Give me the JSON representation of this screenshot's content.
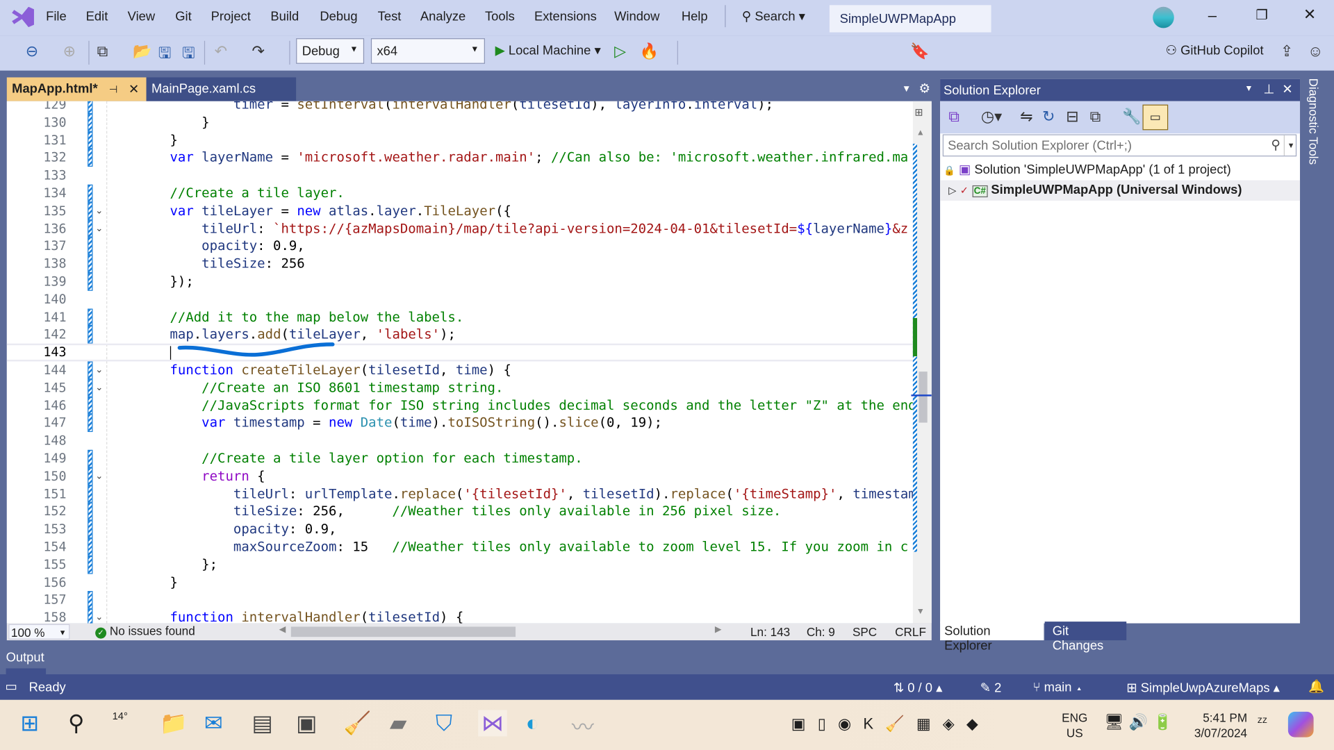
{
  "menu": [
    "File",
    "Edit",
    "View",
    "Git",
    "Project",
    "Build",
    "Debug",
    "Test",
    "Analyze",
    "Tools",
    "Extensions",
    "Window",
    "Help"
  ],
  "search_label": "Search",
  "solution_title": "SimpleUWPMapApp",
  "toolbar": {
    "config": "Debug",
    "platform": "x64",
    "run_target": "Local Machine",
    "copilot": "GitHub Copilot"
  },
  "tabs": [
    {
      "label": "MapApp.html*",
      "active": true
    },
    {
      "label": "MainPage.xaml.cs",
      "active": false
    }
  ],
  "editor": {
    "first_line": 129,
    "current_line": 143,
    "lines": [
      [
        [
          "p",
          "                "
        ],
        [
          "i",
          "timer"
        ],
        [
          "p",
          " = "
        ],
        [
          "f",
          "setInterval"
        ],
        [
          "p",
          "("
        ],
        [
          "f",
          "intervalHandler"
        ],
        [
          "p",
          "("
        ],
        [
          "i",
          "tilesetId"
        ],
        [
          "p",
          "), "
        ],
        [
          "i",
          "layerInfo"
        ],
        [
          "p",
          "."
        ],
        [
          "i",
          "interval"
        ],
        [
          "p",
          ");"
        ]
      ],
      [
        [
          "p",
          "            }"
        ]
      ],
      [
        [
          "p",
          "        }"
        ]
      ],
      [
        [
          "k",
          "        var "
        ],
        [
          "i",
          "layerName"
        ],
        [
          "p",
          " = "
        ],
        [
          "s",
          "'microsoft.weather.radar.main'"
        ],
        [
          "p",
          "; "
        ],
        [
          "c",
          "//Can also be: 'microsoft.weather.infrared.ma"
        ]
      ],
      [],
      [
        [
          "c",
          "        //Create a tile layer."
        ]
      ],
      [
        [
          "k",
          "        var "
        ],
        [
          "i",
          "tileLayer"
        ],
        [
          "p",
          " = "
        ],
        [
          "k",
          "new "
        ],
        [
          "i",
          "atlas"
        ],
        [
          "p",
          "."
        ],
        [
          "i",
          "layer"
        ],
        [
          "p",
          "."
        ],
        [
          "f",
          "TileLayer"
        ],
        [
          "p",
          "({"
        ]
      ],
      [
        [
          "i",
          "            tileUrl"
        ],
        [
          "p",
          ": "
        ],
        [
          "s",
          "`https://{azMapsDomain}/map/tile?api-version=2024-04-01&tilesetId="
        ],
        [
          "k",
          "${"
        ],
        [
          "i",
          "layerName"
        ],
        [
          "k",
          "}"
        ],
        [
          "s",
          "&z"
        ]
      ],
      [
        [
          "i",
          "            opacity"
        ],
        [
          "p",
          ": 0.9,"
        ]
      ],
      [
        [
          "i",
          "            tileSize"
        ],
        [
          "p",
          ": 256"
        ]
      ],
      [
        [
          "p",
          "        });"
        ]
      ],
      [],
      [
        [
          "c",
          "        //Add it to the map below the labels."
        ]
      ],
      [
        [
          "i",
          "        map"
        ],
        [
          "p",
          "."
        ],
        [
          "i",
          "layers"
        ],
        [
          "p",
          "."
        ],
        [
          "f",
          "add"
        ],
        [
          "p",
          "("
        ],
        [
          "i",
          "tileLayer"
        ],
        [
          "p",
          ", "
        ],
        [
          "s",
          "'labels'"
        ],
        [
          "p",
          ");"
        ]
      ],
      [],
      [
        [
          "k",
          "        function "
        ],
        [
          "f",
          "createTileLayer"
        ],
        [
          "p",
          "("
        ],
        [
          "i",
          "tilesetId"
        ],
        [
          "p",
          ", "
        ],
        [
          "i",
          "time"
        ],
        [
          "p",
          ") {"
        ]
      ],
      [
        [
          "c",
          "            //Create an ISO 8601 timestamp string."
        ]
      ],
      [
        [
          "c",
          "            //JavaScripts format for ISO string includes decimal seconds and the letter \"Z\" at the end"
        ]
      ],
      [
        [
          "k",
          "            var "
        ],
        [
          "i",
          "timestamp"
        ],
        [
          "p",
          " = "
        ],
        [
          "k",
          "new "
        ],
        [
          "t",
          "Date"
        ],
        [
          "p",
          "("
        ],
        [
          "i",
          "time"
        ],
        [
          "p",
          ")."
        ],
        [
          "f",
          "toISOString"
        ],
        [
          "p",
          "()."
        ],
        [
          "f",
          "slice"
        ],
        [
          "p",
          "(0, 19);"
        ]
      ],
      [],
      [
        [
          "c",
          "            //Create a tile layer option for each timestamp."
        ]
      ],
      [
        [
          "r",
          "            return"
        ],
        [
          "p",
          " {"
        ]
      ],
      [
        [
          "i",
          "                tileUrl"
        ],
        [
          "p",
          ": "
        ],
        [
          "i",
          "urlTemplate"
        ],
        [
          "p",
          "."
        ],
        [
          "f",
          "replace"
        ],
        [
          "p",
          "("
        ],
        [
          "s",
          "'{tilesetId}'"
        ],
        [
          "p",
          ", "
        ],
        [
          "i",
          "tilesetId"
        ],
        [
          "p",
          ")."
        ],
        [
          "f",
          "replace"
        ],
        [
          "p",
          "("
        ],
        [
          "s",
          "'{timeStamp}'"
        ],
        [
          "p",
          ", "
        ],
        [
          "i",
          "timestamp"
        ]
      ],
      [
        [
          "i",
          "                tileSize"
        ],
        [
          "p",
          ": 256,      "
        ],
        [
          "c",
          "//Weather tiles only available in 256 pixel size."
        ]
      ],
      [
        [
          "i",
          "                opacity"
        ],
        [
          "p",
          ": 0.9,"
        ]
      ],
      [
        [
          "i",
          "                maxSourceZoom"
        ],
        [
          "p",
          ": 15   "
        ],
        [
          "c",
          "//Weather tiles only available to zoom level 15. If you zoom in c"
        ]
      ],
      [
        [
          "p",
          "            };"
        ]
      ],
      [
        [
          "p",
          "        }"
        ]
      ],
      [],
      [
        [
          "k",
          "        function "
        ],
        [
          "f",
          "intervalHandler"
        ],
        [
          "p",
          "("
        ],
        [
          "i",
          "tilesetId"
        ],
        [
          "p",
          ") {"
        ]
      ]
    ],
    "zoom": "100 %",
    "issues": "No issues found",
    "ln": "Ln: 143",
    "ch": "Ch: 9",
    "spc": "SPC",
    "crlf": "CRLF"
  },
  "solution_explorer": {
    "title": "Solution Explorer",
    "search_placeholder": "Search Solution Explorer (Ctrl+;)",
    "solution": "Solution 'SimpleUWPMapApp' (1 of 1 project)",
    "project": "SimpleUWPMapApp (Universal Windows)",
    "bottom_tabs": [
      "Solution Explorer",
      "Git Changes"
    ]
  },
  "diagnostic_tools": "Diagnostic Tools",
  "output_label": "Output",
  "status": {
    "ready": "Ready",
    "sync": "0 / 0",
    "edits": "2",
    "branch": "main",
    "repo": "SimpleUwpAzureMaps"
  },
  "taskbar": {
    "weather": "14°",
    "lang1": "ENG",
    "lang2": "US",
    "time": "5:41 PM",
    "date": "3/07/2024"
  },
  "colors": {
    "accent": "#40508d",
    "active_tab": "#f5cc84",
    "keyword": "#0000ff",
    "string": "#a31515",
    "comment": "#008000"
  }
}
